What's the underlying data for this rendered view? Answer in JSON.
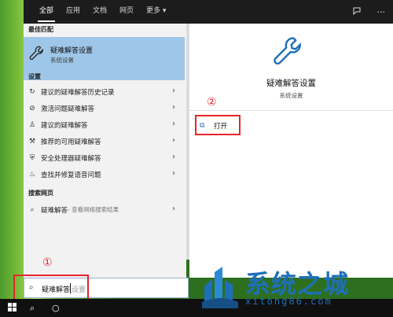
{
  "tabs": [
    "全部",
    "应用",
    "文档",
    "网页",
    "更多 ▾"
  ],
  "best_match": {
    "section": "最佳匹配",
    "title": "疑难解答设置",
    "subtitle": "系统设置"
  },
  "settings": {
    "section": "设置",
    "items": [
      {
        "label": "建议的疑难解答历史记录",
        "icon": "history-icon"
      },
      {
        "label": "激活问题疑难解答",
        "icon": "check-circle-icon"
      },
      {
        "label": "建议的疑难解答",
        "icon": "person-icon"
      },
      {
        "label": "推荐的可用疑难解答",
        "icon": "wrench-icon"
      },
      {
        "label": "安全处理器疑难解答",
        "icon": "shield-icon"
      },
      {
        "label": "查找并修复语音问题",
        "icon": "microphone-icon"
      }
    ]
  },
  "web": {
    "section": "搜索网页",
    "query": "疑难解答",
    "hint": " - 查看网络搜索结果"
  },
  "detail": {
    "title": "疑难解答设置",
    "subtitle": "系统设置",
    "open_label": "打开"
  },
  "search": {
    "typed": "疑难解答",
    "hint": "设置"
  },
  "annotations": {
    "step1": "①",
    "step2": "②"
  },
  "watermark": {
    "title": "系统之城",
    "url": "xitong86.com"
  },
  "colors": {
    "accent": "#1e6fb8",
    "highlight": "#9ec6e8",
    "annotation_red": "#e5262a"
  }
}
